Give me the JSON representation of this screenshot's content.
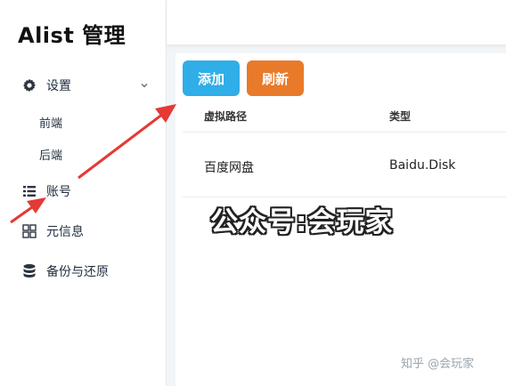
{
  "sidebar": {
    "brand": "Alist 管理",
    "items": [
      {
        "label": "设置",
        "icon": "gear-icon"
      },
      {
        "label": "账号",
        "icon": "list-icon"
      },
      {
        "label": "元信息",
        "icon": "grid-icon"
      },
      {
        "label": "备份与还原",
        "icon": "database-icon"
      }
    ],
    "sub_items": [
      "前端",
      "后端"
    ]
  },
  "toolbar": {
    "add_label": "添加",
    "refresh_label": "刷新"
  },
  "table": {
    "headers": [
      "虚拟路径",
      "类型"
    ],
    "rows": [
      [
        "百度网盘",
        "Baidu.Disk"
      ]
    ]
  },
  "overlay": {
    "watermark": "公众号:会玩家",
    "credit": "知乎 @会玩家"
  },
  "colors": {
    "add_button": "#2faee8",
    "refresh_button": "#e87a2a",
    "annotation_arrow": "#e53935"
  }
}
